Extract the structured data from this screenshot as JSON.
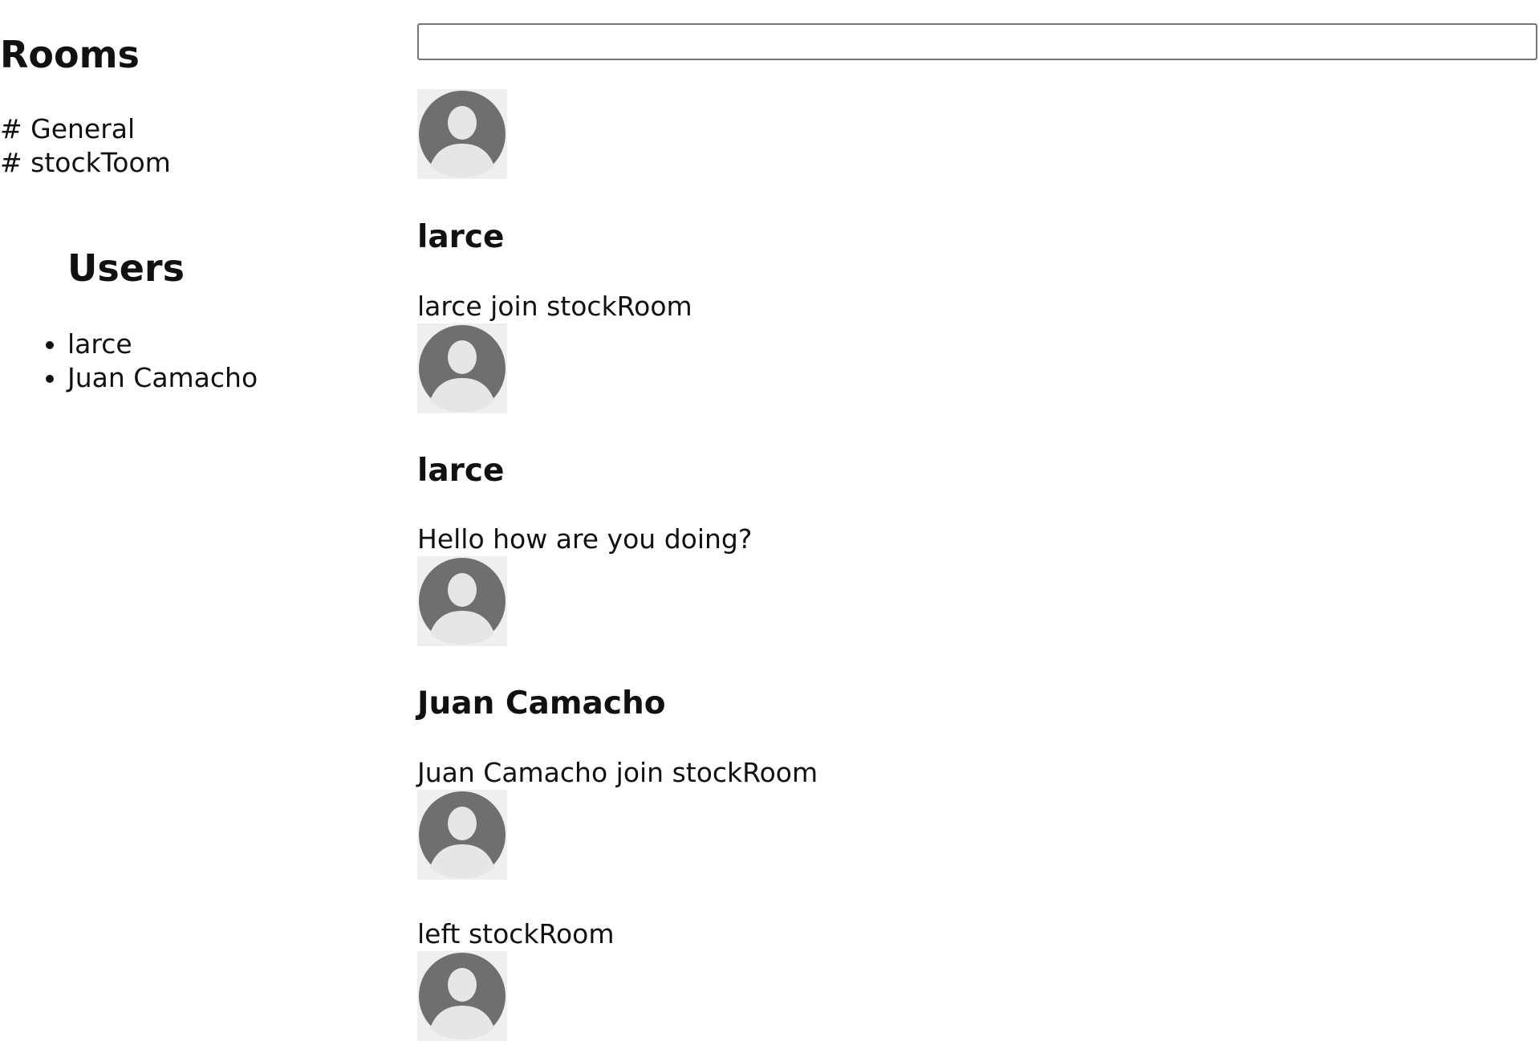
{
  "sidebar": {
    "rooms_title": "Rooms",
    "rooms": [
      {
        "label": "# General"
      },
      {
        "label": "# stockToom"
      }
    ],
    "users_title": "Users",
    "users": [
      {
        "name": "larce"
      },
      {
        "name": "Juan Camacho"
      }
    ]
  },
  "chat": {
    "input": {
      "value": "",
      "placeholder": ""
    },
    "messages": [
      {
        "user": "larce",
        "text": "larce join stockRoom"
      },
      {
        "user": "larce",
        "text": "Hello how are you doing?"
      },
      {
        "user": "Juan Camacho",
        "text": "Juan Camacho join stockRoom"
      },
      {
        "user": "",
        "text": "left stockRoom"
      }
    ]
  },
  "icons": {
    "avatar": "default-user-avatar-icon"
  },
  "colors": {
    "avatar_fg": "#6f6f6f",
    "avatar_body": "#e6e6e6",
    "avatar_bg": "#efefef"
  }
}
